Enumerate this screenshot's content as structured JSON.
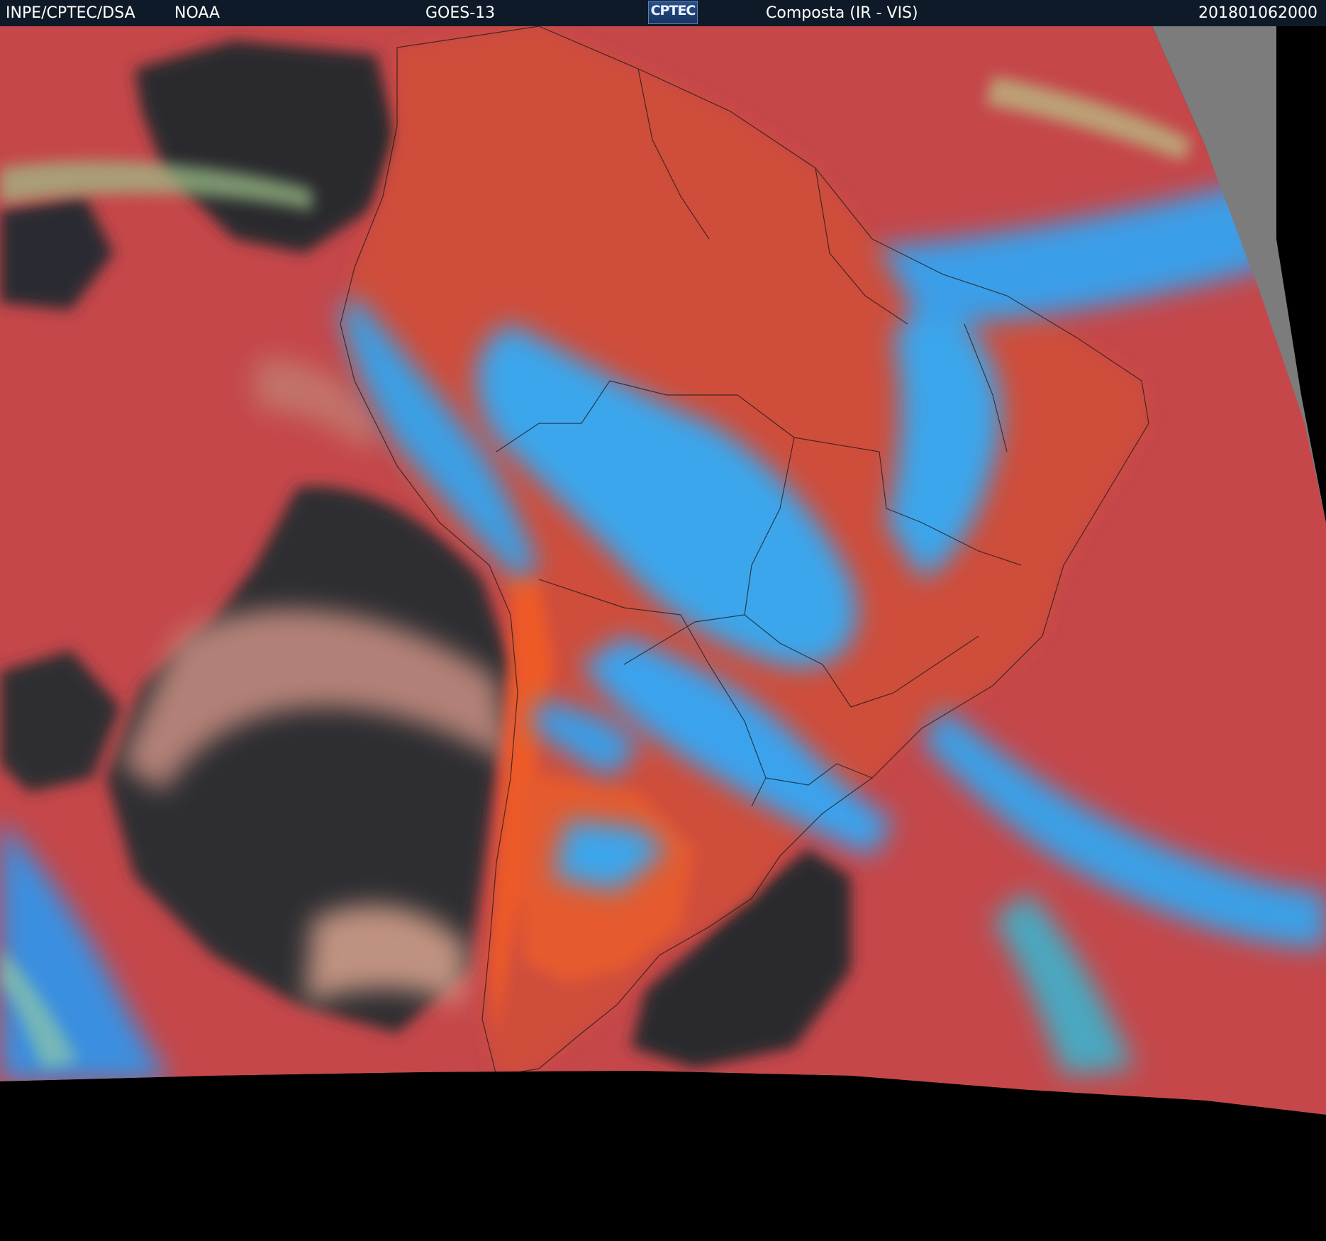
{
  "header": {
    "agency": "INPE/CPTEC/DSA",
    "partner": "NOAA",
    "satellite": "GOES-13",
    "logo_text": "CPTEC",
    "product": "Composta (IR - VIS)",
    "timestamp": "201801062000"
  },
  "colors": {
    "header_bg": "#0f1a28",
    "ocean_clear": "#c5474a",
    "land_clear": "#e05a2c",
    "cloud_cold": "#39a9ee",
    "cloud_low": "#d89a86",
    "dark_region": "#2b2b2b",
    "no_data": "#000000"
  }
}
